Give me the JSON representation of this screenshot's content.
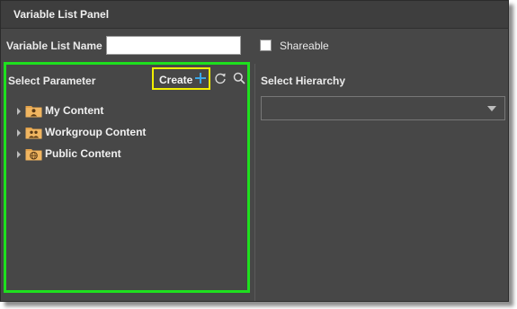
{
  "panel": {
    "title": "Variable List Panel"
  },
  "form": {
    "name_label": "Variable List Name",
    "name_value": "",
    "shareable_label": "Shareable",
    "shareable_checked": false
  },
  "parameters": {
    "label": "Select Parameter",
    "create_label": "Create",
    "tree": [
      {
        "label": "My Content",
        "icon": "user-folder-icon"
      },
      {
        "label": "Workgroup Content",
        "icon": "group-folder-icon"
      },
      {
        "label": "Public Content",
        "icon": "globe-folder-icon"
      }
    ]
  },
  "hierarchy": {
    "label": "Select Hierarchy",
    "selected": ""
  },
  "colors": {
    "highlight_outline": "#1ee01e",
    "create_outline": "#f2ee00",
    "accent_plus": "#3ba6e6"
  }
}
